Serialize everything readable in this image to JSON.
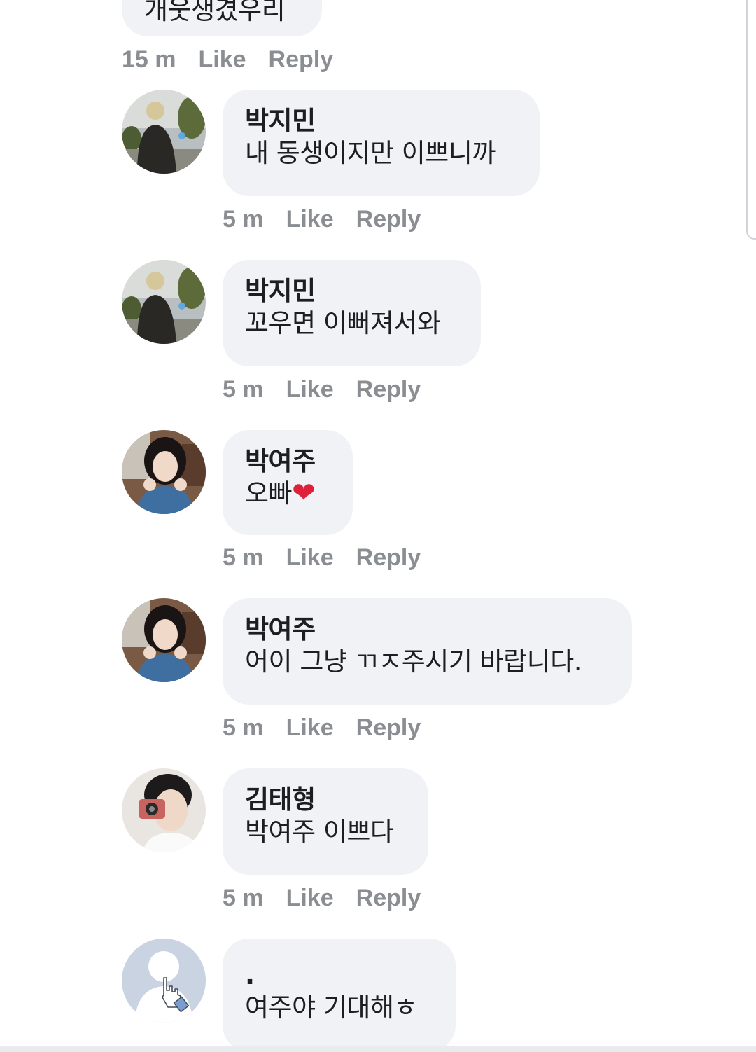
{
  "top_comment": {
    "partial_text": "개웃생겼우리",
    "time": "15 m",
    "like_label": "Like",
    "reply_label": "Reply"
  },
  "comments": [
    {
      "name": "박지민",
      "text": "내 동생이지만 이쁘니까",
      "time": "5 m",
      "like_label": "Like",
      "reply_label": "Reply",
      "avatar": "jimin-avatar"
    },
    {
      "name": "박지민",
      "text": "꼬우면 이뻐져서와",
      "time": "5 m",
      "like_label": "Like",
      "reply_label": "Reply",
      "avatar": "jimin-avatar"
    },
    {
      "name": "박여주",
      "text": "오빠",
      "emoji": "❤",
      "time": "5 m",
      "like_label": "Like",
      "reply_label": "Reply",
      "avatar": "yeoju-avatar"
    },
    {
      "name": "박여주",
      "text": "어이 그냥 ㄲㅈ주시기 바랍니다.",
      "time": "5 m",
      "like_label": "Like",
      "reply_label": "Reply",
      "avatar": "yeoju-avatar"
    },
    {
      "name": "김태형",
      "text": "박여주 이쁘다",
      "time": "5 m",
      "like_label": "Like",
      "reply_label": "Reply",
      "avatar": "taehyung-avatar"
    },
    {
      "name": ".",
      "text": "여주야 기대해ㅎ",
      "avatar": "default-user-avatar"
    }
  ],
  "colors": {
    "bubble": "#f0f2f5",
    "meta_text": "#8a8d91",
    "heart": "#e0203a",
    "default_avatar": "#c9d3e2"
  }
}
